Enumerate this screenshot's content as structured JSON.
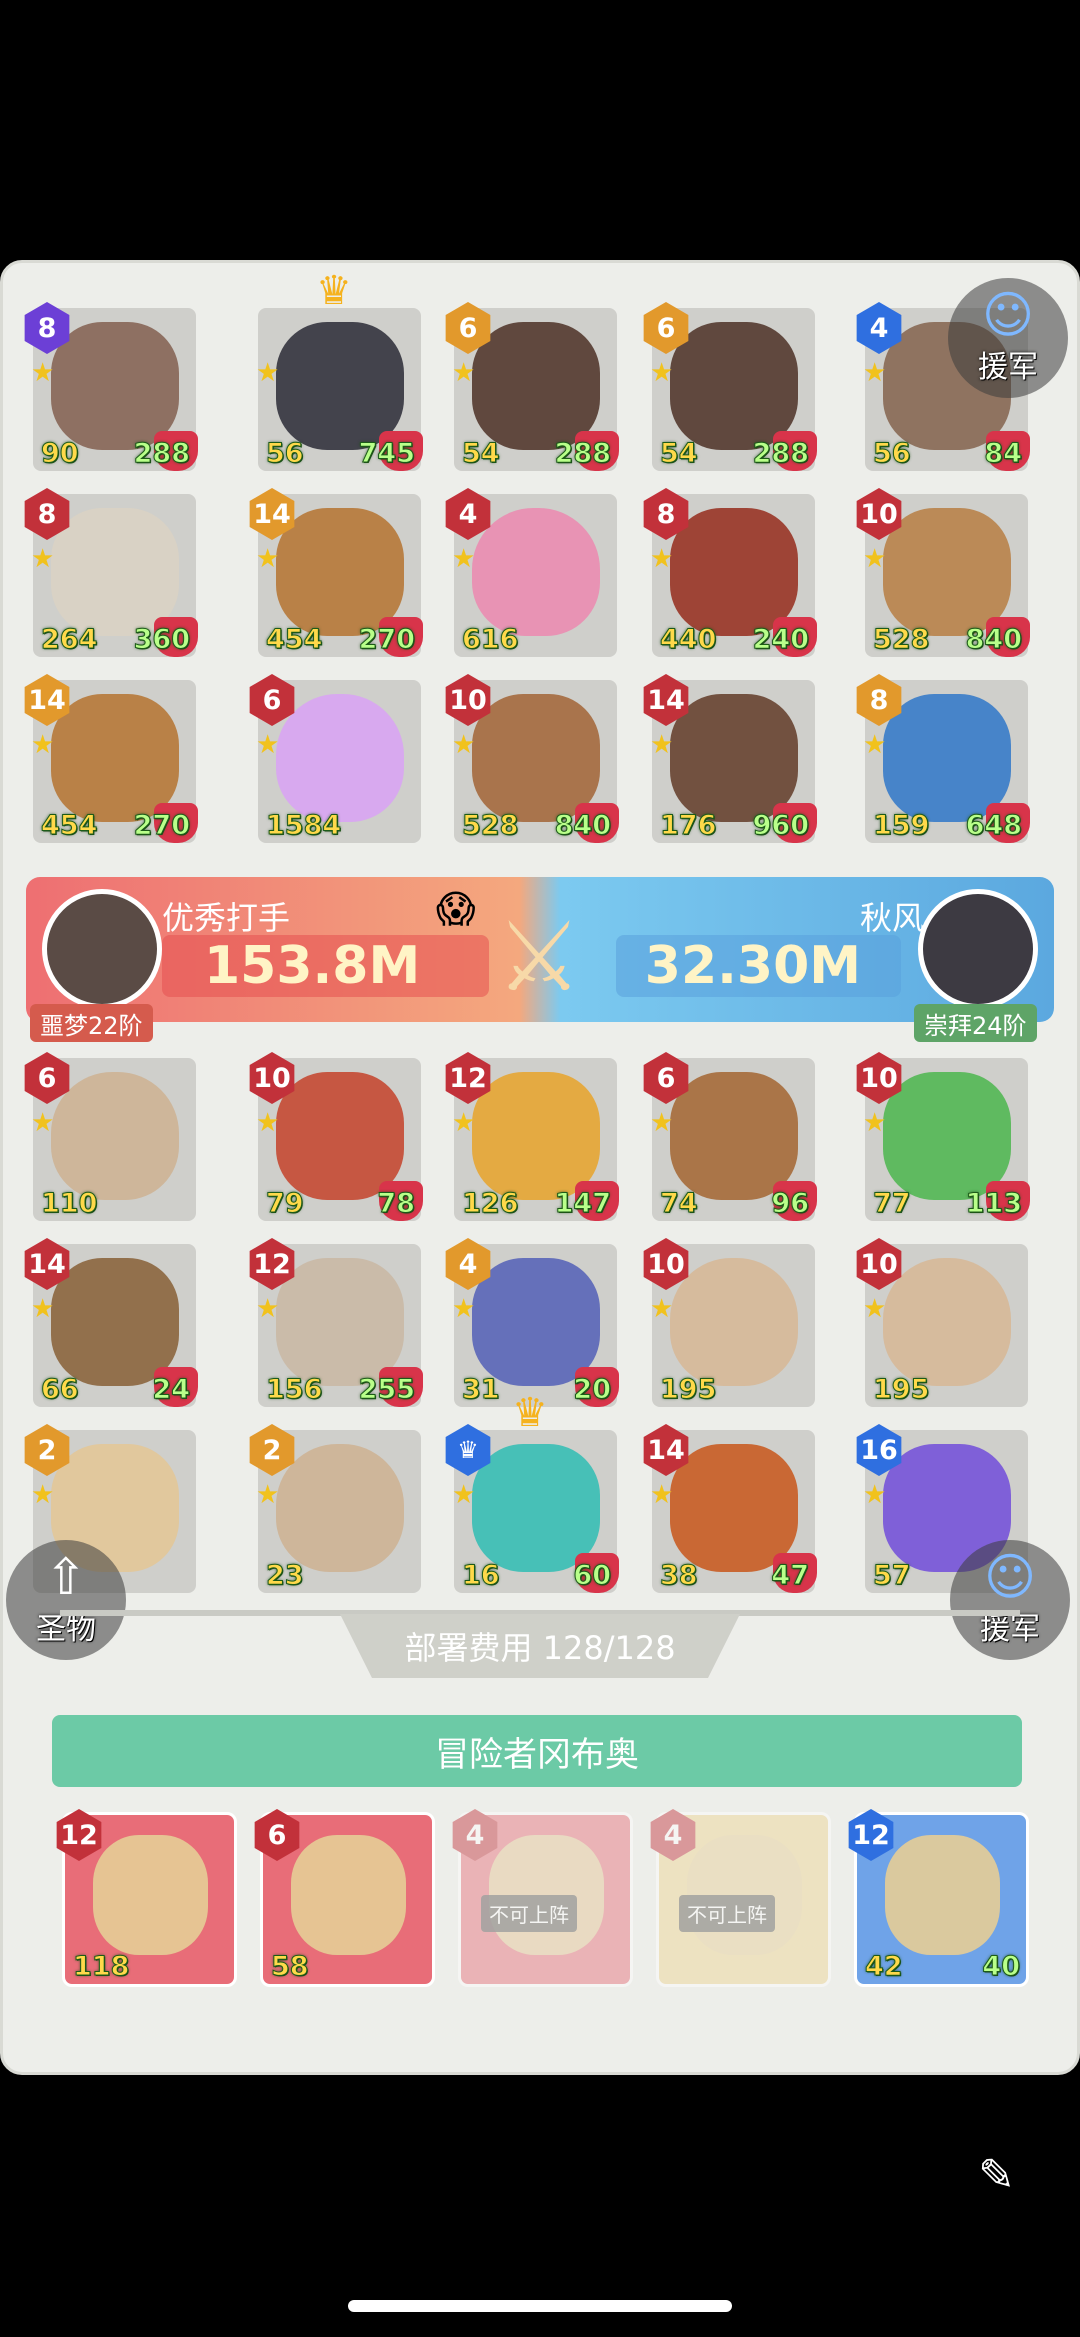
{
  "team_grid": [
    {
      "level": "8",
      "level_color": "purple",
      "left": "90",
      "right": "288",
      "art_color": "#8a6a5c"
    },
    {
      "level": "",
      "level_color": "none",
      "left": "56",
      "right": "745",
      "art_color": "#3b3b44",
      "crown": true
    },
    {
      "level": "6",
      "level_color": "orange",
      "left": "54",
      "right": "288",
      "art_color": "#5a4036"
    },
    {
      "level": "6",
      "level_color": "orange",
      "left": "54",
      "right": "288",
      "art_color": "#5a4036"
    },
    {
      "level": "4",
      "level_color": "blue",
      "left": "56",
      "right": "84",
      "art_color": "#8b6e5a"
    },
    {
      "level": "8",
      "level_color": "red",
      "left": "264",
      "right": "360",
      "art_color": "#d9d2c4"
    },
    {
      "level": "14",
      "level_color": "orange",
      "left": "454",
      "right": "270",
      "art_color": "#b77c3f"
    },
    {
      "level": "4",
      "level_color": "red",
      "left": "616",
      "right": "",
      "art_color": "#e98fb2",
      "egg": true
    },
    {
      "level": "8",
      "level_color": "red",
      "left": "440",
      "right": "240",
      "art_color": "#9b3c2d"
    },
    {
      "level": "10",
      "level_color": "red",
      "left": "528",
      "right": "840",
      "art_color": "#b98650"
    },
    {
      "level": "14",
      "level_color": "orange",
      "left": "454",
      "right": "270",
      "art_color": "#b77c3f"
    },
    {
      "level": "6",
      "level_color": "red",
      "left": "1584",
      "right": "",
      "art_color": "#d8a6f0",
      "egg": true
    },
    {
      "level": "10",
      "level_color": "red",
      "left": "528",
      "right": "840",
      "art_color": "#a66f44"
    },
    {
      "level": "14",
      "level_color": "red",
      "left": "176",
      "right": "960",
      "art_color": "#6d4a38"
    },
    {
      "level": "8",
      "level_color": "orange",
      "left": "159",
      "right": "648",
      "art_color": "#3f7fc8"
    }
  ],
  "vs_banner": {
    "left_name": "优秀打手",
    "left_power": "153.8M",
    "left_rank": "噩梦22阶",
    "right_name": "秋风",
    "right_power": "32.30M",
    "right_rank": "崇拜24阶"
  },
  "enemy_grid": [
    {
      "level": "6",
      "level_color": "red",
      "left": "110",
      "right": "",
      "art_color": "#cdb497",
      "egg": true
    },
    {
      "level": "10",
      "level_color": "red",
      "left": "79",
      "right": "78",
      "art_color": "#c5503a"
    },
    {
      "level": "12",
      "level_color": "red",
      "left": "126",
      "right": "147",
      "art_color": "#e5a83a"
    },
    {
      "level": "6",
      "level_color": "red",
      "left": "74",
      "right": "96",
      "art_color": "#a87040"
    },
    {
      "level": "10",
      "level_color": "red",
      "left": "77",
      "right": "113",
      "art_color": "#58b85a"
    },
    {
      "level": "14",
      "level_color": "red",
      "left": "66",
      "right": "24",
      "art_color": "#8e6a45"
    },
    {
      "level": "12",
      "level_color": "red",
      "left": "156",
      "right": "255",
      "art_color": "#c9b9a6"
    },
    {
      "level": "4",
      "level_color": "orange",
      "left": "31",
      "right": "20",
      "art_color": "#5f6ab8"
    },
    {
      "level": "10",
      "level_color": "red",
      "left": "195",
      "right": "",
      "art_color": "#d6b99a",
      "egg": true
    },
    {
      "level": "10",
      "level_color": "red",
      "left": "195",
      "right": "",
      "art_color": "#d6b99a",
      "egg": true
    },
    {
      "level": "2",
      "level_color": "orange",
      "left": "",
      "right": "",
      "art_color": "#e2c79a"
    },
    {
      "level": "2",
      "level_color": "orange",
      "left": "23",
      "right": "",
      "art_color": "#cdb497",
      "egg": true
    },
    {
      "level": "",
      "level_color": "crown",
      "left": "16",
      "right": "60",
      "art_color": "#3fbfb5",
      "crown": true
    },
    {
      "level": "14",
      "level_color": "red",
      "left": "38",
      "right": "47",
      "art_color": "#c8622b"
    },
    {
      "level": "16",
      "level_color": "blue",
      "left": "57",
      "right": "",
      "art_color": "#7a5ad8"
    }
  ],
  "side_buttons": {
    "reinforce_top": "援军",
    "relic": "圣物",
    "reinforce_bottom": "援军"
  },
  "deploy_cost": "部署费用 128/128",
  "adventurer_button": "冒险者冈布奥",
  "bench": [
    {
      "level": "12",
      "value": "118",
      "bg": "#e86d78",
      "locked": false
    },
    {
      "level": "6",
      "value": "58",
      "bg": "#e86d78",
      "locked": false
    },
    {
      "level": "4",
      "value": "",
      "bg": "#e86d78",
      "locked": true,
      "tag": "不可上阵"
    },
    {
      "level": "4",
      "value": "",
      "bg": "#efd590",
      "locked": true,
      "tag": "不可上阵"
    },
    {
      "level": "12",
      "value": "42",
      "value2": "40",
      "bg": "#6fa3e8",
      "locked": false
    }
  ]
}
